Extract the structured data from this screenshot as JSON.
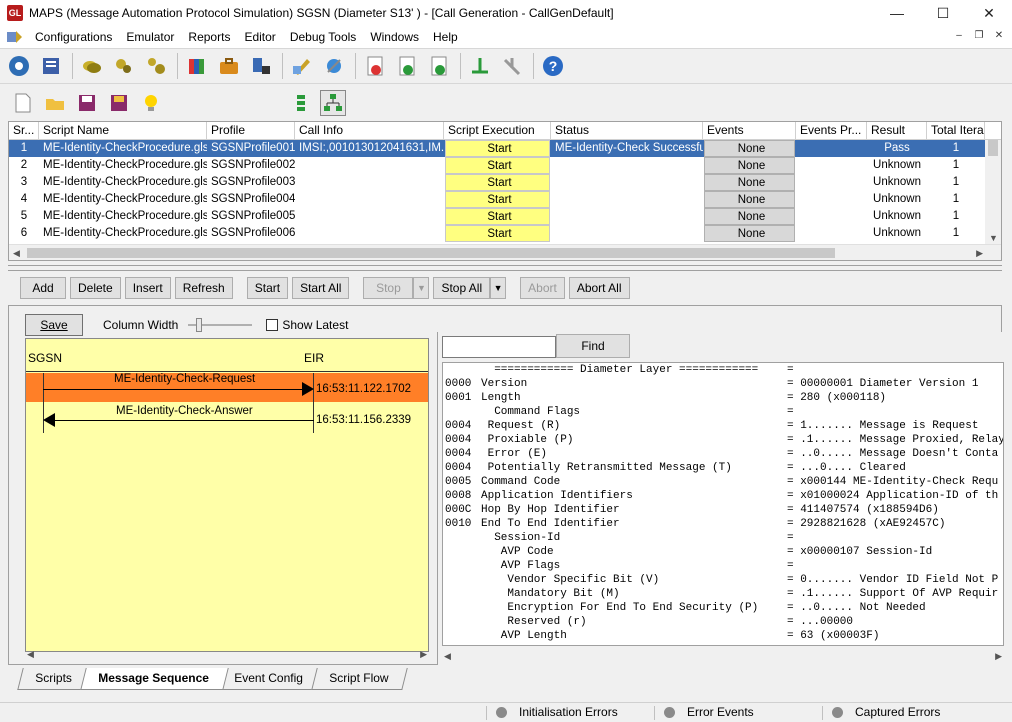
{
  "window": {
    "title": "MAPS (Message Automation Protocol Simulation) SGSN (Diameter S13' ) - [Call Generation  - CallGenDefault]",
    "app_icon_text": "GL"
  },
  "menu": [
    "Configurations",
    "Emulator",
    "Reports",
    "Editor",
    "Debug Tools",
    "Windows",
    "Help"
  ],
  "grid": {
    "columns": [
      "Sr...",
      "Script Name",
      "Profile",
      "Call Info",
      "Script Execution",
      "Status",
      "Events",
      "Events Pr...",
      "Result",
      "Total Itera"
    ],
    "rows": [
      {
        "sr": "1",
        "script": "ME-Identity-CheckProcedure.gls",
        "profile": "SGSNProfile001",
        "callinfo": "IMSI:,001013012041631,IM...",
        "exec": "Start",
        "status": "ME-Identity-Check Successful...",
        "events": "None",
        "events_pr": "",
        "result": "Pass",
        "total": "1"
      },
      {
        "sr": "2",
        "script": "ME-Identity-CheckProcedure.gls",
        "profile": "SGSNProfile002",
        "callinfo": "",
        "exec": "Start",
        "status": "",
        "events": "None",
        "events_pr": "",
        "result": "Unknown",
        "total": "1"
      },
      {
        "sr": "3",
        "script": "ME-Identity-CheckProcedure.gls",
        "profile": "SGSNProfile003",
        "callinfo": "",
        "exec": "Start",
        "status": "",
        "events": "None",
        "events_pr": "",
        "result": "Unknown",
        "total": "1"
      },
      {
        "sr": "4",
        "script": "ME-Identity-CheckProcedure.gls",
        "profile": "SGSNProfile004",
        "callinfo": "",
        "exec": "Start",
        "status": "",
        "events": "None",
        "events_pr": "",
        "result": "Unknown",
        "total": "1"
      },
      {
        "sr": "5",
        "script": "ME-Identity-CheckProcedure.gls",
        "profile": "SGSNProfile005",
        "callinfo": "",
        "exec": "Start",
        "status": "",
        "events": "None",
        "events_pr": "",
        "result": "Unknown",
        "total": "1"
      },
      {
        "sr": "6",
        "script": "ME-Identity-CheckProcedure.gls",
        "profile": "SGSNProfile006",
        "callinfo": "",
        "exec": "Start",
        "status": "",
        "events": "None",
        "events_pr": "",
        "result": "Unknown",
        "total": "1"
      }
    ]
  },
  "buttons": {
    "add": "Add",
    "delete": "Delete",
    "insert": "Insert",
    "refresh": "Refresh",
    "start": "Start",
    "start_all": "Start All",
    "stop": "Stop",
    "stop_all": "Stop All",
    "abort": "Abort",
    "abort_all": "Abort All"
  },
  "sequence": {
    "save": "Save",
    "column_width_label": "Column Width",
    "show_latest_label": "Show Latest",
    "node_left": "SGSN",
    "node_right": "EIR",
    "messages": [
      {
        "label": "ME-Identity-Check-Request",
        "time": "16:53:11.122.1702",
        "direction": "right",
        "highlighted": true
      },
      {
        "label": "ME-Identity-Check-Answer",
        "time": "16:53:11.156.2339",
        "direction": "left",
        "highlighted": false
      }
    ]
  },
  "decode": {
    "find_label": "Find",
    "find_value": "",
    "lines": [
      {
        "off": "",
        "field": "  ============ Diameter Layer ============",
        "val": "="
      },
      {
        "off": "0000",
        "field": "Version",
        "val": "= 00000001 Diameter Version 1"
      },
      {
        "off": "0001",
        "field": "Length",
        "val": "= 280 (x000118)"
      },
      {
        "off": "",
        "field": "  Command Flags",
        "val": "="
      },
      {
        "off": "0004",
        "field": " Request (R)",
        "val": "= 1....... Message is Request"
      },
      {
        "off": "0004",
        "field": " Proxiable (P)",
        "val": "= .1...... Message Proxied, Relay"
      },
      {
        "off": "0004",
        "field": " Error (E)",
        "val": "= ..0..... Message Doesn't Conta"
      },
      {
        "off": "0004",
        "field": " Potentially Retransmitted Message (T)",
        "val": "= ...0.... Cleared"
      },
      {
        "off": "0005",
        "field": "Command Code",
        "val": "= x000144 ME-Identity-Check Requ"
      },
      {
        "off": "0008",
        "field": "Application Identifiers",
        "val": "= x01000024 Application-ID of th"
      },
      {
        "off": "000C",
        "field": "Hop By Hop Identifier",
        "val": "= 411407574 (x188594D6)"
      },
      {
        "off": "0010",
        "field": "End To End Identifier",
        "val": "= 2928821628 (xAE92457C)"
      },
      {
        "off": "",
        "field": "  Session-Id",
        "val": "="
      },
      {
        "off": "",
        "field": "   AVP Code",
        "val": "= x00000107 Session-Id"
      },
      {
        "off": "",
        "field": "   AVP Flags",
        "val": "="
      },
      {
        "off": "",
        "field": "    Vendor Specific Bit (V)",
        "val": "= 0....... Vendor ID Field Not P"
      },
      {
        "off": "",
        "field": "    Mandatory Bit (M)",
        "val": "= .1...... Support Of AVP Requir"
      },
      {
        "off": "",
        "field": "    Encryption For End To End Security (P)",
        "val": "= ..0..... Not Needed"
      },
      {
        "off": "",
        "field": "    Reserved (r)",
        "val": "= ...00000"
      },
      {
        "off": "",
        "field": "   AVP Length",
        "val": "= 63 (x00003F)"
      }
    ]
  },
  "tabs": [
    {
      "label": "Scripts",
      "active": false
    },
    {
      "label": "Message Sequence",
      "active": true
    },
    {
      "label": "Event Config",
      "active": false
    },
    {
      "label": "Script Flow",
      "active": false
    }
  ],
  "statusbar": {
    "init_errors": "Initialisation Errors",
    "error_events": "Error Events",
    "captured_errors": "Captured Errors"
  },
  "colors": {
    "selection": "#3b6eb3",
    "start_cell": "#ffff80",
    "sequence_bg": "#ffffa8",
    "highlight_msg": "#ff7f27"
  }
}
